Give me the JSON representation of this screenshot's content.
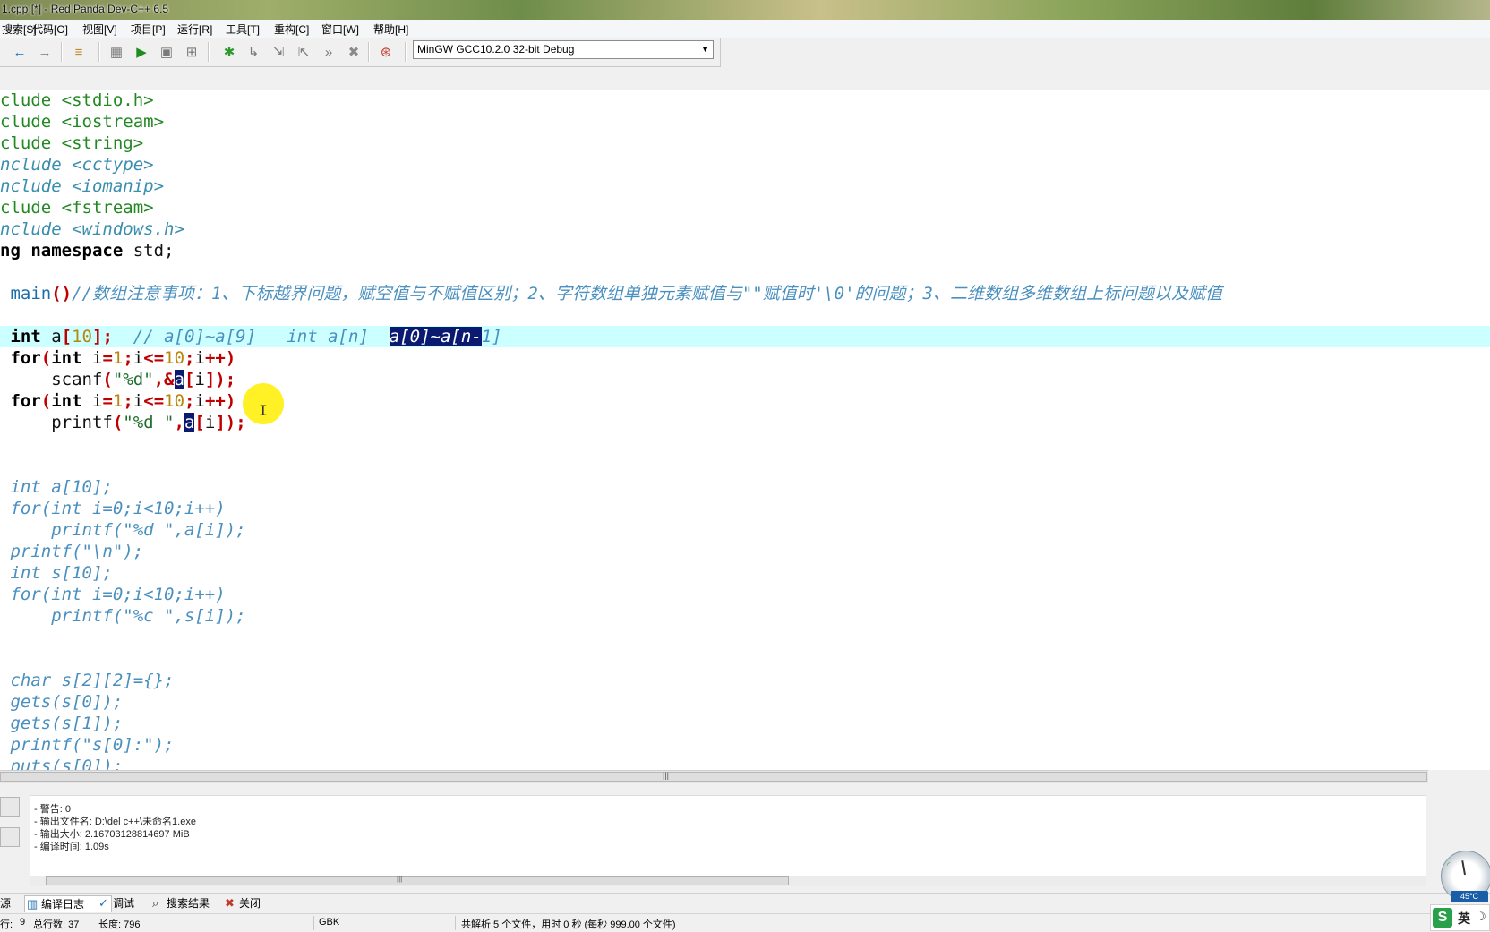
{
  "window": {
    "title": "1.cpp [*] - Red Panda Dev-C++ 6.5"
  },
  "menu": [
    "搜索[S]",
    "代码[O]",
    "视图[V]",
    "项目[P]",
    "运行[R]",
    "工具[T]",
    "重构[C]",
    "窗口[W]",
    "帮助[H]"
  ],
  "toolbar": {
    "icons": [
      "back-arrow-icon",
      "forward-arrow-icon",
      "format-icon",
      "compile-icon",
      "run-icon",
      "compile-run-icon",
      "rebuild-icon",
      "debug-icon",
      "step-over-icon",
      "step-into-icon",
      "step-out-icon",
      "continue-icon",
      "stop-icon",
      "watch-icon"
    ],
    "compiler": "MinGW GCC10.2.0 32-bit Debug"
  },
  "editor": {
    "lines": [
      [
        [
          "pp",
          "clude <stdio.h>"
        ]
      ],
      [
        [
          "pp",
          "clude <iostream>"
        ]
      ],
      [
        [
          "pp",
          "clude <string>"
        ]
      ],
      [
        [
          "pi",
          "nclude <cctype>"
        ]
      ],
      [
        [
          "pi",
          "nclude <iomanip>"
        ]
      ],
      [
        [
          "pp",
          "clude <fstream>"
        ]
      ],
      [
        [
          "pi",
          "nclude <windows.h>"
        ]
      ],
      [
        [
          "kw",
          "ng namespace "
        ],
        [
          "id",
          "std;"
        ]
      ],
      [
        [
          "id",
          ""
        ]
      ],
      [
        [
          "id",
          " "
        ],
        [
          "cm-plain",
          "main"
        ],
        [
          "op",
          "()"
        ],
        [
          "cm",
          "//数组注意事项：1、下标越界问题，赋空值与不赋值区别；2、字符数组单独元素赋值与\"\"赋值时'\\0'的问题；3、二维数组多维数组上标问题以及赋值"
        ]
      ],
      [
        [
          "id",
          ""
        ]
      ],
      [
        [
          "kw",
          " int "
        ],
        [
          "id",
          "a"
        ],
        [
          "op",
          "["
        ],
        [
          "num",
          "10"
        ],
        [
          "op",
          "];"
        ],
        [
          "cm",
          "  // a[0]~a[9]   int a[n]  "
        ],
        [
          "sel-em",
          "a[0]~a[n-"
        ],
        [
          "cm",
          "1]"
        ]
      ],
      [
        [
          "kw",
          " for"
        ],
        [
          "op",
          "("
        ],
        [
          "kw",
          "int "
        ],
        [
          "id",
          "i"
        ],
        [
          "op",
          "="
        ],
        [
          "num",
          "1"
        ],
        [
          "op",
          ";"
        ],
        [
          "id",
          "i"
        ],
        [
          "op",
          "<="
        ],
        [
          "num",
          "10"
        ],
        [
          "op",
          ";"
        ],
        [
          "id",
          "i"
        ],
        [
          "op",
          "++)"
        ]
      ],
      [
        [
          "id",
          "     scanf"
        ],
        [
          "op",
          "("
        ],
        [
          "str",
          "\"%d\""
        ],
        [
          "op",
          ",&"
        ],
        [
          "sel",
          "a"
        ],
        [
          "op",
          "["
        ],
        [
          "id",
          "i"
        ],
        [
          "op",
          "]);"
        ]
      ],
      [
        [
          "kw",
          " for"
        ],
        [
          "op",
          "("
        ],
        [
          "kw",
          "int "
        ],
        [
          "id",
          "i"
        ],
        [
          "op",
          "="
        ],
        [
          "num",
          "1"
        ],
        [
          "op",
          ";"
        ],
        [
          "id",
          "i"
        ],
        [
          "op",
          "<="
        ],
        [
          "num",
          "10"
        ],
        [
          "op",
          ";"
        ],
        [
          "id",
          "i"
        ],
        [
          "op",
          "++)"
        ]
      ],
      [
        [
          "id",
          "     printf"
        ],
        [
          "op",
          "("
        ],
        [
          "str",
          "\"%d \""
        ],
        [
          "op",
          ","
        ],
        [
          "sel",
          "a"
        ],
        [
          "op",
          "["
        ],
        [
          "id",
          "i"
        ],
        [
          "op",
          "]);"
        ]
      ],
      [
        [
          "id",
          ""
        ]
      ],
      [
        [
          "id",
          ""
        ]
      ],
      [
        [
          "cm",
          " int a[10];"
        ]
      ],
      [
        [
          "cm",
          " for(int i=0;i<10;i++)"
        ]
      ],
      [
        [
          "cm",
          "     printf(\"%d \",a[i]);"
        ]
      ],
      [
        [
          "cm",
          " printf(\"\\n\");"
        ]
      ],
      [
        [
          "cm",
          " int s[10];"
        ]
      ],
      [
        [
          "cm",
          " for(int i=0;i<10;i++)"
        ]
      ],
      [
        [
          "cm",
          "     printf(\"%c \",s[i]);"
        ]
      ],
      [
        [
          "id",
          ""
        ]
      ],
      [
        [
          "id",
          ""
        ]
      ],
      [
        [
          "cm",
          " char s[2][2]={};"
        ]
      ],
      [
        [
          "cm",
          " gets(s[0]);"
        ]
      ],
      [
        [
          "cm",
          " gets(s[1]);"
        ]
      ],
      [
        [
          "cm",
          " printf(\"s[0]:\");"
        ]
      ],
      [
        [
          "cm",
          " puts(s[0]);"
        ]
      ]
    ],
    "highlighted_line": 11
  },
  "log": {
    "lines": [
      "- 警告: 0",
      "- 输出文件名: D:\\del c++\\未命名1.exe",
      "- 输出大小: 2.16703128814697 MiB",
      "- 编译时间: 1.09s"
    ]
  },
  "tabs": [
    {
      "label": "源",
      "icon": "resource-icon"
    },
    {
      "label": "编译日志",
      "icon": "compile-log-icon"
    },
    {
      "label": "调试",
      "icon": "debug-tab-icon"
    },
    {
      "label": "搜索结果",
      "icon": "search-icon"
    },
    {
      "label": "关闭",
      "icon": "close-icon"
    }
  ],
  "status": {
    "line_label": "行:",
    "col": "9",
    "total_lines": "总行数: 37",
    "length": "长度: 796",
    "encoding": "GBK",
    "parse_info": "共解析 5 个文件，用时 0 秒 (每秒 999.00 个文件)"
  },
  "system": {
    "temp": "45°C",
    "ime_lang": "英"
  }
}
